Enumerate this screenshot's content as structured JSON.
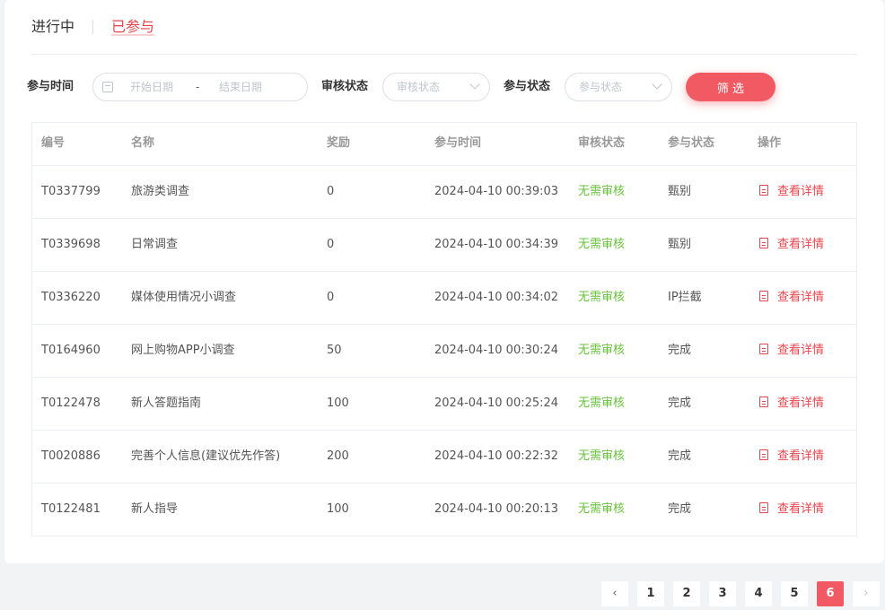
{
  "tabs": [
    {
      "label": "进行中",
      "active": false
    },
    {
      "label": "已参与",
      "active": true
    }
  ],
  "filter": {
    "time_label": "参与时间",
    "start_placeholder": "开始日期",
    "range_sep": "-",
    "end_placeholder": "结束日期",
    "review_label": "审核状态",
    "review_placeholder": "审核状态",
    "participate_label": "参与状态",
    "participate_placeholder": "参与状态",
    "button": "筛 选"
  },
  "table": {
    "headers": [
      "编号",
      "名称",
      "奖励",
      "参与时间",
      "审核状态",
      "参与状态",
      "操作"
    ],
    "rows": [
      {
        "id": "T0337799",
        "name": "旅游类调查",
        "reward": "0",
        "time": "2024-04-10 00:39:03",
        "review": "无需审核",
        "status": "甄别",
        "action": "查看详情"
      },
      {
        "id": "T0339698",
        "name": "日常调查",
        "reward": "0",
        "time": "2024-04-10 00:34:39",
        "review": "无需审核",
        "status": "甄别",
        "action": "查看详情"
      },
      {
        "id": "T0336220",
        "name": "媒体使用情况小调查",
        "reward": "0",
        "time": "2024-04-10 00:34:02",
        "review": "无需审核",
        "status": "IP拦截",
        "action": "查看详情"
      },
      {
        "id": "T0164960",
        "name": "网上购物APP小调查",
        "reward": "50",
        "time": "2024-04-10 00:30:24",
        "review": "无需审核",
        "status": "完成",
        "action": "查看详情"
      },
      {
        "id": "T0122478",
        "name": "新人答题指南",
        "reward": "100",
        "time": "2024-04-10 00:25:24",
        "review": "无需审核",
        "status": "完成",
        "action": "查看详情"
      },
      {
        "id": "T0020886",
        "name": "完善个人信息(建议优先作答)",
        "reward": "200",
        "time": "2024-04-10 00:22:32",
        "review": "无需审核",
        "status": "完成",
        "action": "查看详情"
      },
      {
        "id": "T0122481",
        "name": "新人指导",
        "reward": "100",
        "time": "2024-04-10 00:20:13",
        "review": "无需审核",
        "status": "完成",
        "action": "查看详情"
      }
    ]
  },
  "pagination": {
    "prev": "‹",
    "pages": [
      "1",
      "2",
      "3",
      "4",
      "5",
      "6"
    ],
    "current": "6",
    "next": "›"
  },
  "colors": {
    "accent": "#f25a63",
    "status_ok": "#67c23a"
  }
}
